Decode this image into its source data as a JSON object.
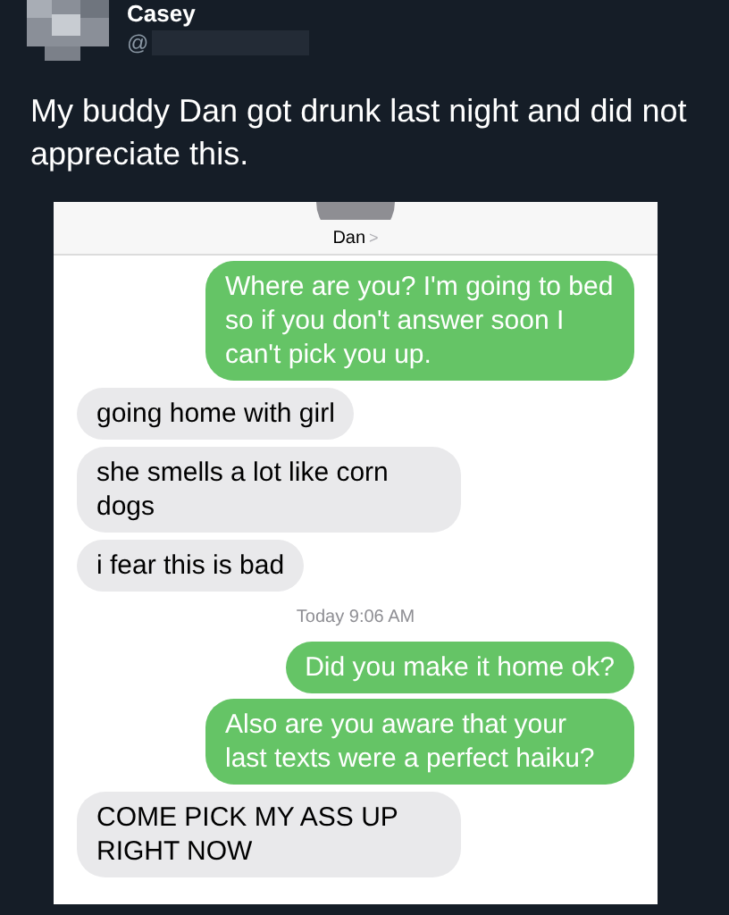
{
  "author": {
    "name": "Casey",
    "handle": "@"
  },
  "tweet_text": "My buddy Dan got drunk last night and did not appreciate this.",
  "conversation": {
    "contact": "Dan",
    "chevron": ">",
    "messages": [
      {
        "kind": "sent",
        "text": "Where are you? I'm going to bed so if you don't answer soon I can't pick you up."
      },
      {
        "kind": "received",
        "text": "going home with girl"
      },
      {
        "kind": "received",
        "text": "she smells a lot like corn dogs"
      },
      {
        "kind": "received",
        "text": "i fear this is bad"
      },
      {
        "kind": "timestamp",
        "text": "Today 9:06 AM"
      },
      {
        "kind": "sent",
        "text": "Did you make it home ok?"
      },
      {
        "kind": "sent",
        "text": "Also are you aware that your last texts were a perfect haiku?"
      },
      {
        "kind": "received",
        "text": "COME PICK MY ASS UP RIGHT NOW"
      }
    ]
  }
}
